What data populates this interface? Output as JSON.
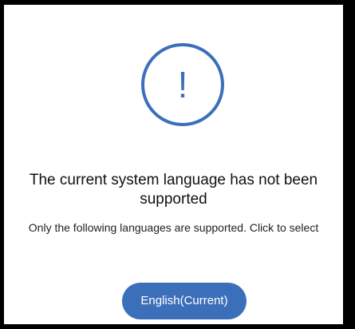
{
  "dialog": {
    "icon": "exclamation-circle-icon",
    "icon_glyph": "!",
    "title": "The current system language has not been supported",
    "message": "Only the following languages are supported. Click to select",
    "languages": [
      {
        "label": "English(Current)"
      }
    ]
  },
  "colors": {
    "accent": "#3c6fba",
    "background": "#ffffff",
    "frame": "#000000"
  }
}
